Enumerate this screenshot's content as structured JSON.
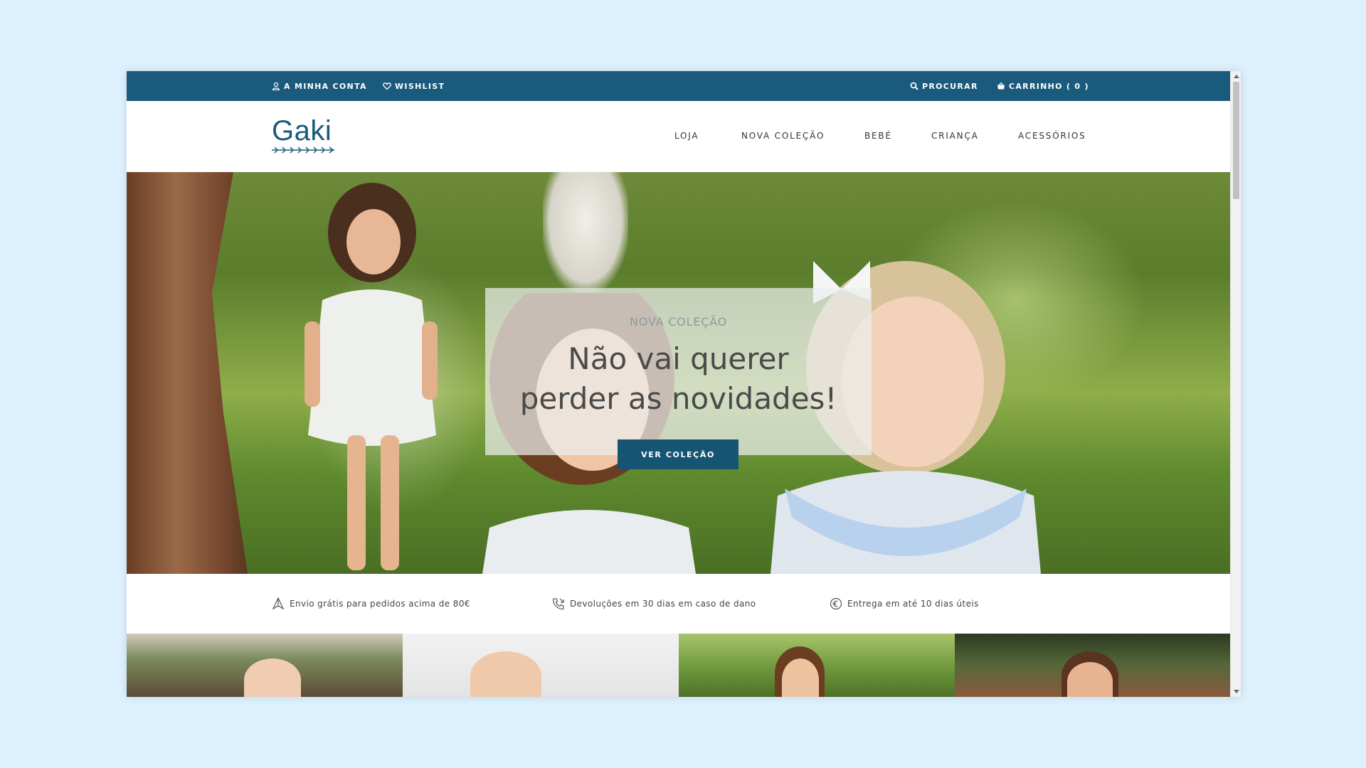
{
  "topbar": {
    "account": "A MINHA CONTA",
    "wishlist": "WISHLIST",
    "search": "PROCURAR",
    "cart": "CARRINHO ( 0 )"
  },
  "header": {
    "logo": "Gaki",
    "nav": [
      "LOJA",
      "NOVA COLEÇÃO",
      "BEBÉ",
      "CRIANÇA",
      "ACESSÓRIOS"
    ]
  },
  "hero": {
    "eyebrow": "NOVA COLEÇÃO",
    "title_line1": "Não vai querer",
    "title_line2": "perder as novidades!",
    "button": "VER COLEÇÃO"
  },
  "features": [
    {
      "icon": "plane-icon",
      "text": "Envio grátis para pedidos acima de 80€"
    },
    {
      "icon": "return-call-icon",
      "text": "Devoluções em 30 dias em caso de dano"
    },
    {
      "icon": "euro-icon",
      "text": "Entrega em até 10 dias úteis"
    }
  ],
  "colors": {
    "brand": "#1a5a7c",
    "button": "#165474",
    "background": "#dcf0fd"
  }
}
